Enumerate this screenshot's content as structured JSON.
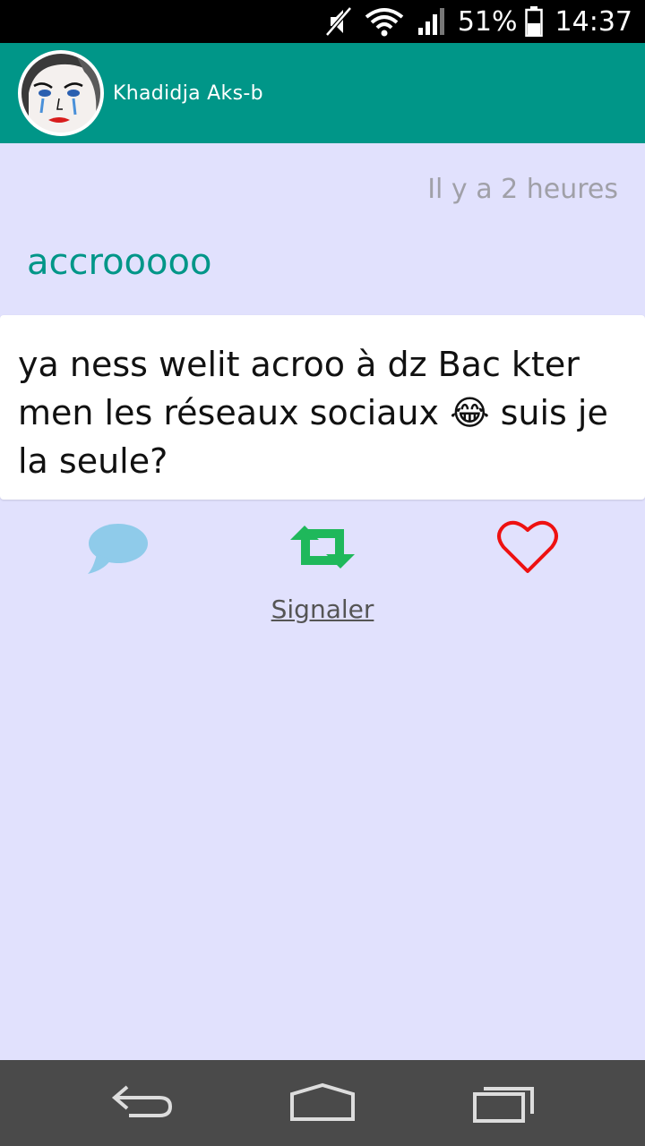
{
  "status_bar": {
    "battery": "51%",
    "time": "14:37",
    "icons": [
      "mute-icon",
      "wifi-icon",
      "signal-icon",
      "battery-icon"
    ]
  },
  "app_bar": {
    "user_name": "Khadidja Aks-b",
    "color": "#009688"
  },
  "post": {
    "time_ago": "Il y a 2 heures",
    "title": "accrooooo",
    "body": "ya ness welit acroo à dz Bac kter men les réseaux sociaux 😂 suis je la seule?"
  },
  "actions": {
    "comment_icon": "comment-icon",
    "repost_icon": "repost-icon",
    "like_icon": "heart-icon",
    "report_label": "Signaler"
  },
  "nav_bar": {
    "icons": [
      "back-icon",
      "home-icon",
      "recents-icon"
    ]
  },
  "colors": {
    "background": "#e1e1fd",
    "accent": "#009688",
    "comment": "#8fcbea",
    "repost": "#1fb85b",
    "like": "#ee1111"
  }
}
